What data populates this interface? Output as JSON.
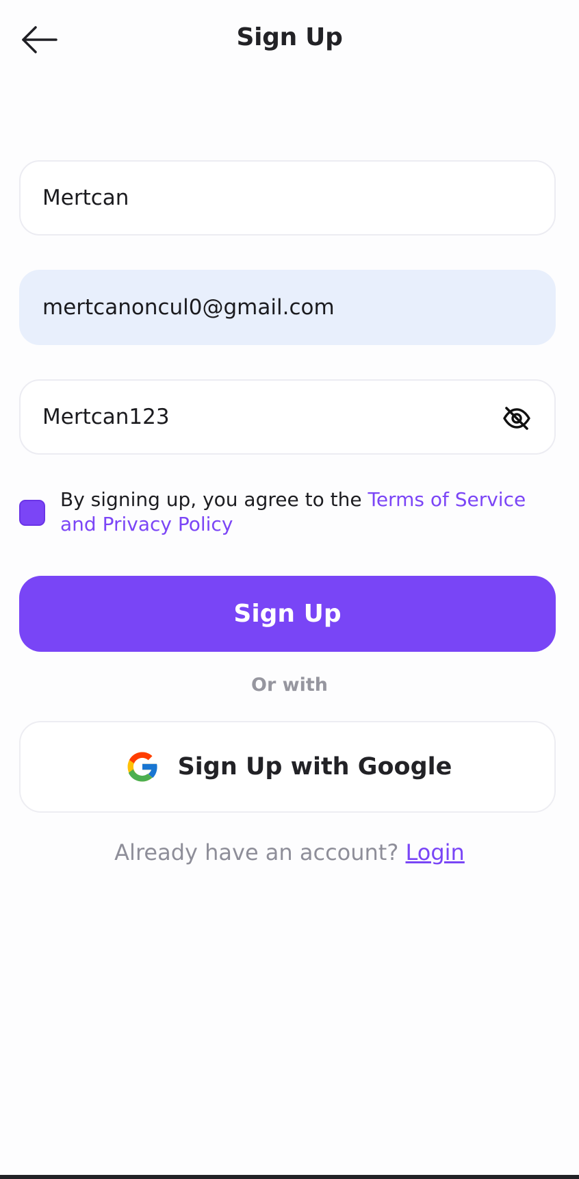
{
  "header": {
    "title": "Sign Up",
    "back_icon": "arrow-left-icon"
  },
  "form": {
    "name_value": "Mertcan",
    "email_value": "mertcanoncul0@gmail.com",
    "password_value": "Mertcan123",
    "password_toggle_icon": "eye-off-icon"
  },
  "terms": {
    "checked": true,
    "prefix": "By signing up, you agree to the ",
    "link": "Terms of Service and Privacy Policy"
  },
  "signup_button": {
    "label": "Sign Up"
  },
  "divider": {
    "label": "Or with"
  },
  "google_button": {
    "label": "Sign Up with Google",
    "icon": "google-icon"
  },
  "login": {
    "prompt": "Already have an account? ",
    "link": "Login"
  },
  "colors": {
    "accent": "#7945f6",
    "autofill_bg": "#e8effc",
    "muted_text": "#8e8e99",
    "border": "#ececf2"
  }
}
